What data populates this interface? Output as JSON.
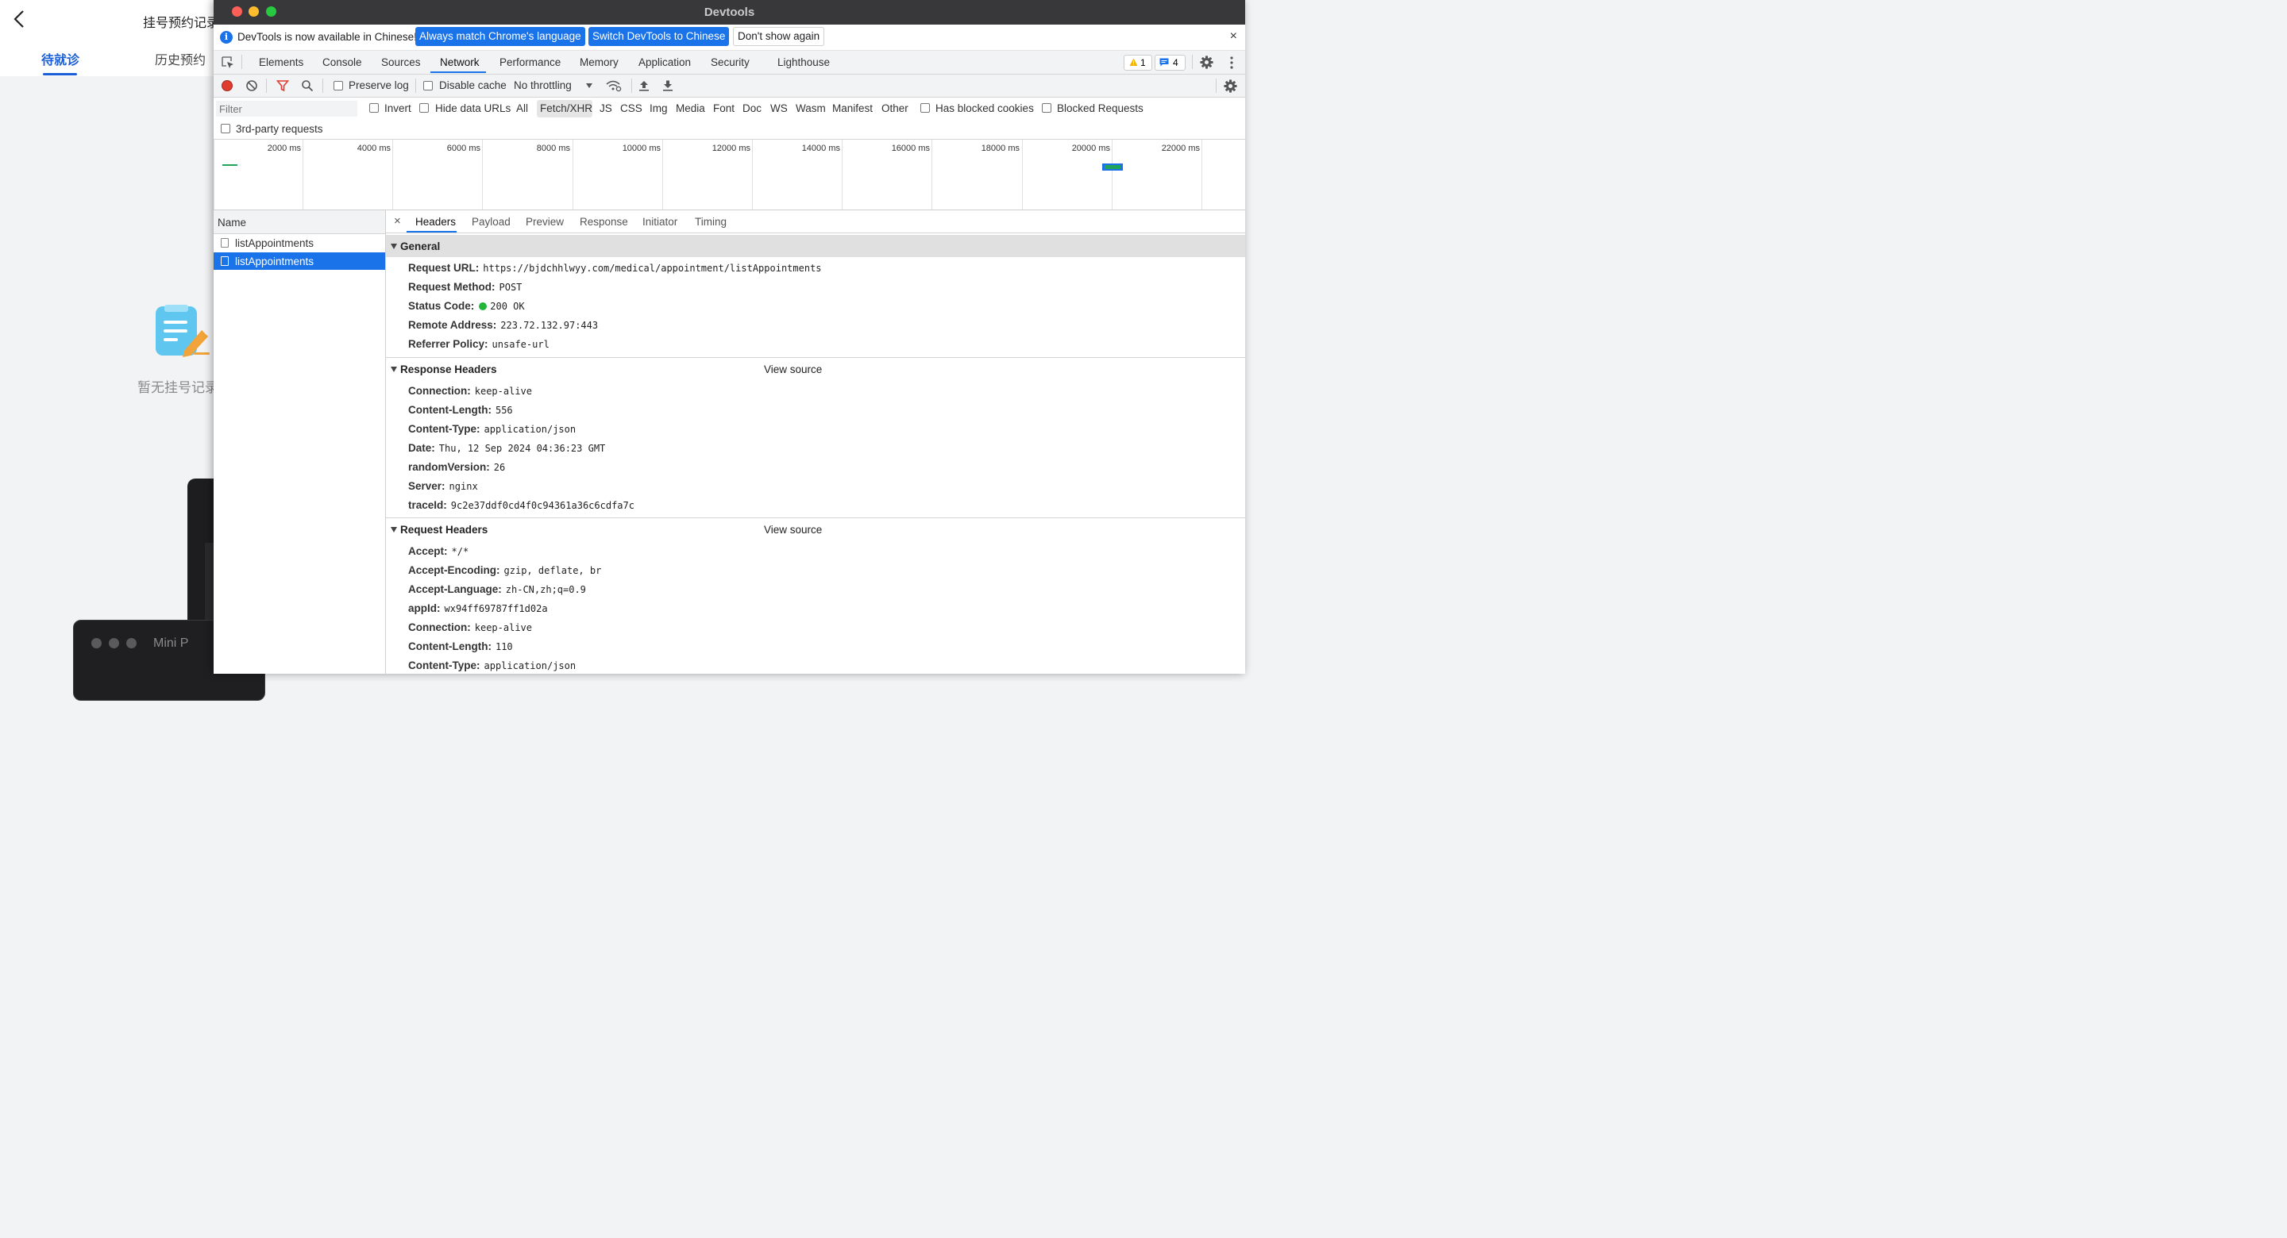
{
  "app": {
    "title": "挂号预约记录",
    "tabs": [
      "待就诊",
      "历史预约"
    ],
    "empty_text": "暂无挂号记录"
  },
  "bg_window": {
    "title": "Mini P"
  },
  "devtools": {
    "window_title": "Devtools",
    "infobar": {
      "message": "DevTools is now available in Chinese!",
      "btn_match": "Always match Chrome's language",
      "btn_switch": "Switch DevTools to Chinese",
      "btn_dont": "Don't show again",
      "close": "×"
    },
    "main_tabs": [
      "Elements",
      "Console",
      "Sources",
      "Network",
      "Performance",
      "Memory",
      "Application",
      "Security",
      "Lighthouse"
    ],
    "active_main_tab": "Network",
    "issues": {
      "warnings": "1",
      "messages": "4"
    },
    "toolbar": {
      "preserve_log": "Preserve log",
      "disable_cache": "Disable cache",
      "throttling": "No throttling"
    },
    "filter": {
      "placeholder": "Filter",
      "invert": "Invert",
      "hide_data_urls": "Hide data URLs",
      "types": [
        "All",
        "Fetch/XHR",
        "JS",
        "CSS",
        "Img",
        "Media",
        "Font",
        "Doc",
        "WS",
        "Wasm",
        "Manifest",
        "Other"
      ],
      "active_type": "Fetch/XHR",
      "has_blocked_cookies": "Has blocked cookies",
      "blocked_requests": "Blocked Requests",
      "third_party": "3rd-party requests"
    },
    "timeline_ticks": [
      "2000 ms",
      "4000 ms",
      "6000 ms",
      "8000 ms",
      "10000 ms",
      "12000 ms",
      "14000 ms",
      "16000 ms",
      "18000 ms",
      "20000 ms",
      "22000 ms"
    ],
    "requests": {
      "header": "Name",
      "rows": [
        "listAppointments",
        "listAppointments"
      ],
      "selected_index": 1
    },
    "detail_tabs": [
      "Headers",
      "Payload",
      "Preview",
      "Response",
      "Initiator",
      "Timing"
    ],
    "active_detail_tab": "Headers",
    "general": {
      "title": "General",
      "request_url_k": "Request URL:",
      "request_url": "https://bjdchhlwyy.com/medical/appointment/listAppointments",
      "method_k": "Request Method:",
      "method": "POST",
      "status_k": "Status Code:",
      "status": "200 OK",
      "status_color": "#22b53a",
      "remote_k": "Remote Address:",
      "remote": "223.72.132.97:443",
      "referrer_k": "Referrer Policy:",
      "referrer": "unsafe-url"
    },
    "view_source": "View source",
    "response_headers": {
      "title": "Response Headers",
      "items": [
        {
          "k": "Connection:",
          "v": "keep-alive"
        },
        {
          "k": "Content-Length:",
          "v": "556"
        },
        {
          "k": "Content-Type:",
          "v": "application/json"
        },
        {
          "k": "Date:",
          "v": "Thu, 12 Sep 2024 04:36:23 GMT"
        },
        {
          "k": "randomVersion:",
          "v": "26"
        },
        {
          "k": "Server:",
          "v": "nginx"
        },
        {
          "k": "traceId:",
          "v": "9c2e37ddf0cd4f0c94361a36c6cdfa7c"
        }
      ]
    },
    "request_headers": {
      "title": "Request Headers",
      "items": [
        {
          "k": "Accept:",
          "v": "*/*"
        },
        {
          "k": "Accept-Encoding:",
          "v": "gzip, deflate, br"
        },
        {
          "k": "Accept-Language:",
          "v": "zh-CN,zh;q=0.9"
        },
        {
          "k": "appId:",
          "v": "wx94ff69787ff1d02a"
        },
        {
          "k": "Connection:",
          "v": "keep-alive"
        },
        {
          "k": "Content-Length:",
          "v": "110"
        },
        {
          "k": "Content-Type:",
          "v": "application/json"
        }
      ]
    },
    "colors": {
      "accent": "#1a73e8",
      "record": "#e03b2f",
      "titlebar": "#38383a"
    }
  }
}
